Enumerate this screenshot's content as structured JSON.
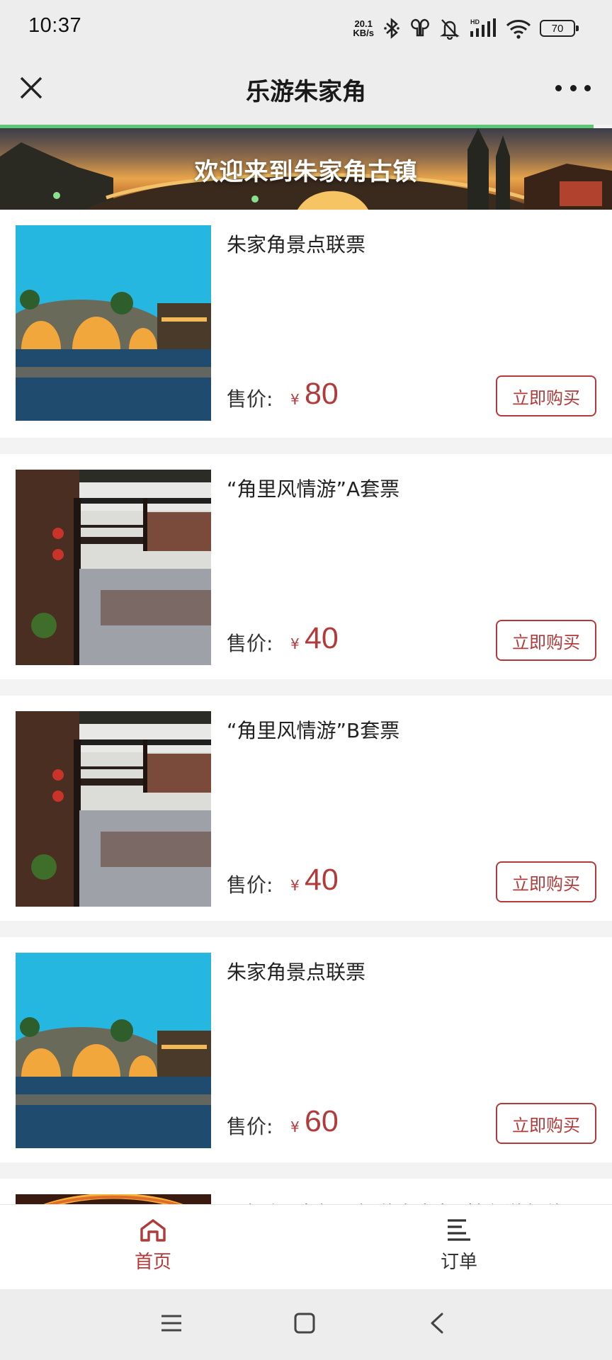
{
  "status_bar": {
    "time": "10:37",
    "net_speed_value": "20.1",
    "net_speed_unit": "KB/s",
    "battery": "70",
    "icons": [
      "bluetooth-icon",
      "earbuds-icon",
      "bell-muted-icon",
      "hd-signal-icon",
      "wifi-icon",
      "battery-icon"
    ]
  },
  "title_bar": {
    "title": "乐游朱家角",
    "close_icon": "close-icon",
    "more_icon": "more-icon"
  },
  "banner": {
    "text": "欢迎来到朱家角古镇"
  },
  "products": [
    {
      "name": "朱家角景点联票",
      "price_label": "售价:",
      "currency": "¥",
      "price": "80",
      "buy_label": "立即购买",
      "image": "stone-bridge-photo"
    },
    {
      "name": "“角里风情游”A套票",
      "price_label": "售价:",
      "currency": "¥",
      "price": "40",
      "buy_label": "立即购买",
      "image": "canal-corridor-photo"
    },
    {
      "name": "“角里风情游”B套票",
      "price_label": "售价:",
      "currency": "¥",
      "price": "40",
      "buy_label": "立即购买",
      "image": "canal-corridor-photo"
    },
    {
      "name": "朱家角景点联票",
      "price_label": "售价:",
      "currency": "¥",
      "price": "60",
      "buy_label": "立即购买",
      "image": "stone-bridge-photo"
    },
    {
      "name": "“珠溪三官船・船游朱家角”特色游船体",
      "price_label": "",
      "currency": "",
      "price": "",
      "buy_label": "",
      "image": "lantern-photo"
    }
  ],
  "tab_bar": {
    "tabs": [
      {
        "label": "首页",
        "icon": "home-icon",
        "active": true
      },
      {
        "label": "订单",
        "icon": "list-icon",
        "active": false
      }
    ]
  },
  "colors": {
    "accent": "#b33a3a",
    "progress": "#5cc873",
    "background": "#f3f3f3"
  }
}
